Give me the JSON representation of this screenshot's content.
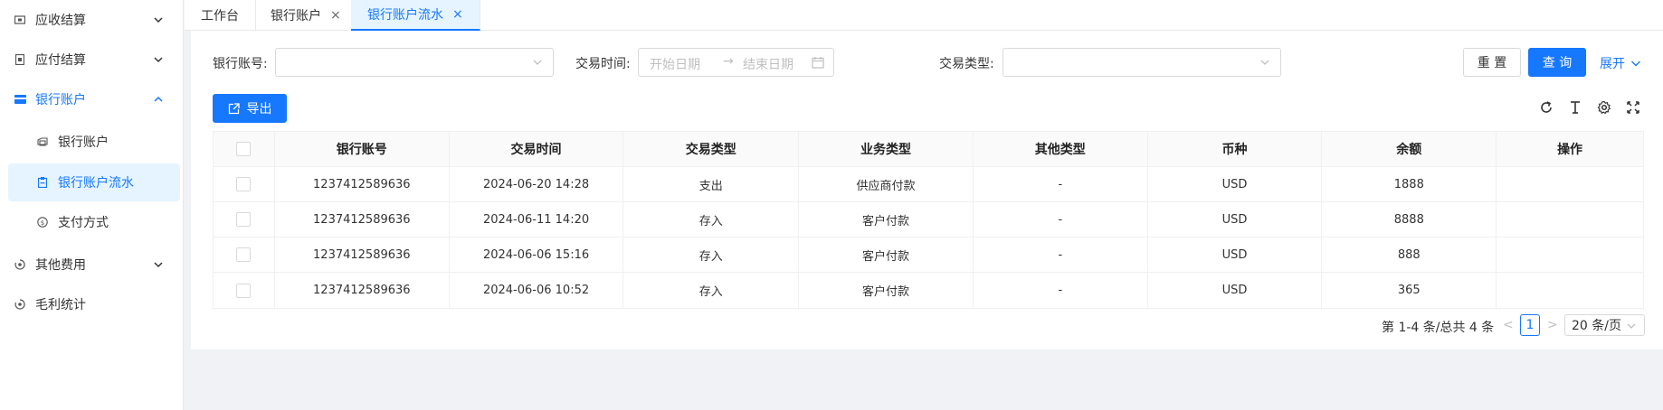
{
  "sidebar": {
    "items": [
      {
        "label": "应收结算",
        "icon": "ticket-icon"
      },
      {
        "label": "应付结算",
        "icon": "document-icon"
      },
      {
        "label": "银行账户",
        "icon": "card-icon"
      },
      {
        "label": "其他费用",
        "icon": "coin-icon"
      },
      {
        "label": "毛利统计",
        "icon": "coin-icon"
      }
    ],
    "bank_children": [
      {
        "label": "银行账户",
        "icon": "folder-icon"
      },
      {
        "label": "银行账户流水",
        "icon": "clipboard-icon"
      },
      {
        "label": "支付方式",
        "icon": "currency-icon"
      }
    ]
  },
  "tabs": [
    {
      "label": "工作台"
    },
    {
      "label": "银行账户",
      "closable": "×"
    },
    {
      "label": "银行账户流水",
      "closable": "×"
    }
  ],
  "filters": {
    "bank_account_label": "银行账号:",
    "trade_time_label": "交易时间:",
    "start_placeholder": "开始日期",
    "end_placeholder": "结束日期",
    "range_arrow": "→",
    "trade_type_label": "交易类型:"
  },
  "buttons": {
    "reset": "重 置",
    "query": "查 询",
    "expand": "展开",
    "export": "导出"
  },
  "table": {
    "headers": [
      "银行账号",
      "交易时间",
      "交易类型",
      "业务类型",
      "其他类型",
      "币种",
      "余额",
      "操作"
    ],
    "rows": [
      [
        "1237412589636",
        "2024-06-20 14:28",
        "支出",
        "供应商付款",
        "-",
        "USD",
        "1888",
        ""
      ],
      [
        "1237412589636",
        "2024-06-11 14:20",
        "存入",
        "客户付款",
        "-",
        "USD",
        "8888",
        ""
      ],
      [
        "1237412589636",
        "2024-06-06 15:16",
        "存入",
        "客户付款",
        "-",
        "USD",
        "888",
        ""
      ],
      [
        "1237412589636",
        "2024-06-06 10:52",
        "存入",
        "客户付款",
        "-",
        "USD",
        "365",
        ""
      ]
    ]
  },
  "pagination": {
    "summary": "第 1-4 条/总共 4 条",
    "prev": "<",
    "current": "1",
    "next": ">",
    "page_size": "20 条/页"
  },
  "colors": {
    "primary": "#1677ff",
    "selected_bg": "#e6f4ff"
  }
}
